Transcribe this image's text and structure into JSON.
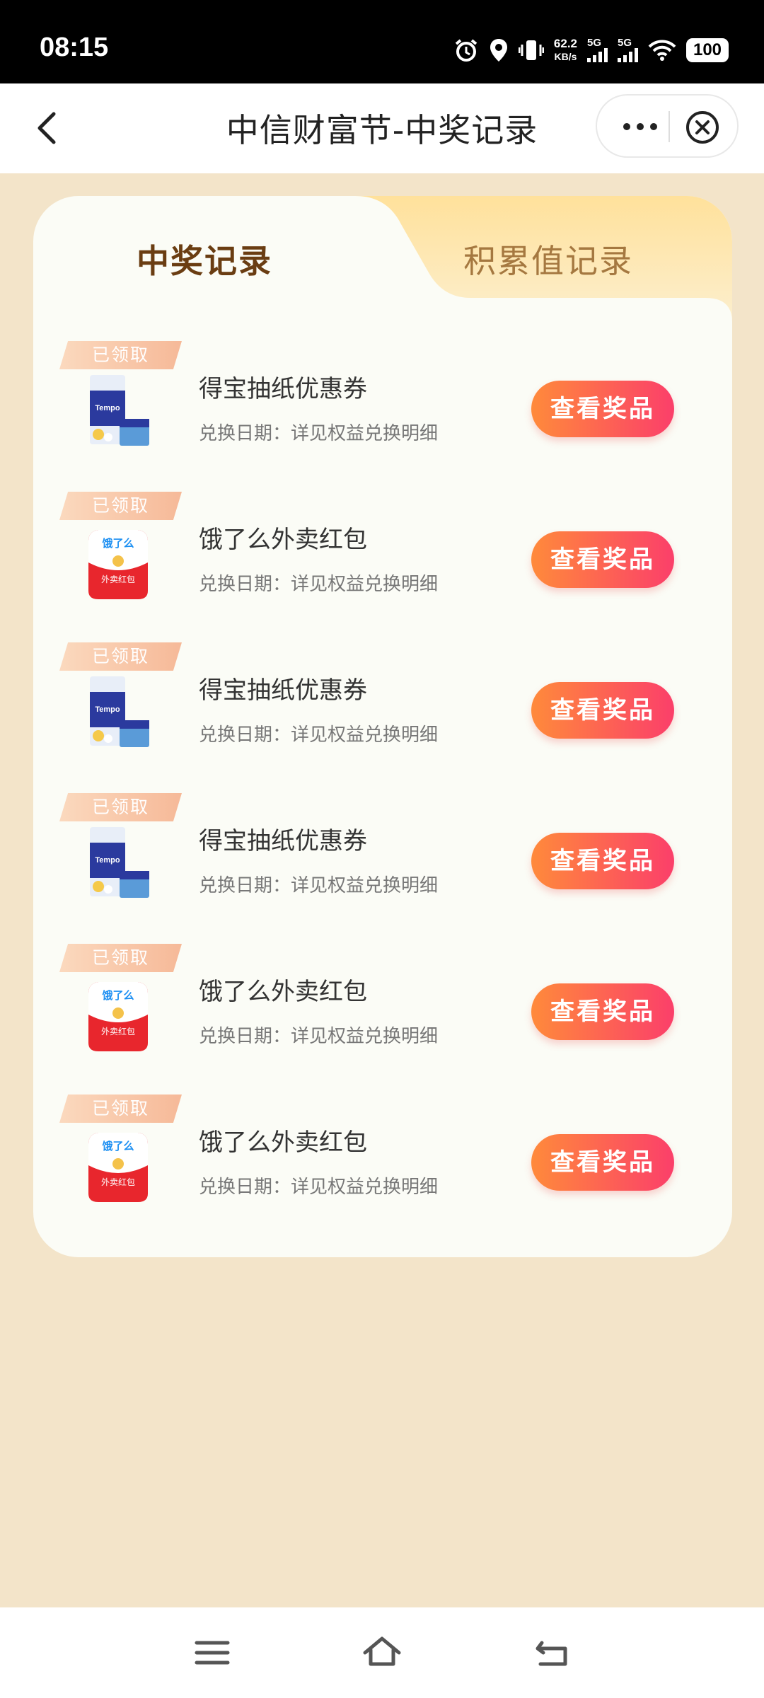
{
  "status_bar": {
    "time": "08:15",
    "net_speed": "62.2",
    "net_unit": "KB/s",
    "sim1": "5G",
    "sim2": "5G",
    "battery": "100",
    "icons": [
      "alarm-icon",
      "location-icon",
      "vibrate-icon",
      "signal-icon",
      "signal-icon",
      "wifi-icon",
      "battery-icon"
    ]
  },
  "header": {
    "title": "中信财富节-中奖记录",
    "back_icon": "chevron-left-icon",
    "more_icon": "more-dots-icon",
    "close_icon": "close-circle-icon"
  },
  "tabs": [
    {
      "label": "中奖记录",
      "active": true
    },
    {
      "label": "积累值记录",
      "active": false
    }
  ],
  "records": [
    {
      "status": "已领取",
      "title": "得宝抽纸优惠券",
      "date": "兑换日期：详见权益兑换明细",
      "button": "查看奖品",
      "thumb": "tissue"
    },
    {
      "status": "已领取",
      "title": "饿了么外卖红包",
      "date": "兑换日期：详见权益兑换明细",
      "button": "查看奖品",
      "thumb": "eleme"
    },
    {
      "status": "已领取",
      "title": "得宝抽纸优惠券",
      "date": "兑换日期：详见权益兑换明细",
      "button": "查看奖品",
      "thumb": "tissue"
    },
    {
      "status": "已领取",
      "title": "得宝抽纸优惠券",
      "date": "兑换日期：详见权益兑换明细",
      "button": "查看奖品",
      "thumb": "tissue"
    },
    {
      "status": "已领取",
      "title": "饿了么外卖红包",
      "date": "兑换日期：详见权益兑换明细",
      "button": "查看奖品",
      "thumb": "eleme"
    },
    {
      "status": "已领取",
      "title": "饿了么外卖红包",
      "date": "兑换日期：详见权益兑换明细",
      "button": "查看奖品",
      "thumb": "eleme"
    }
  ],
  "thumb_text": {
    "tissue_brand": "Tempo",
    "eleme_logo": "饿了么",
    "eleme_label": "外卖红包"
  },
  "colors": {
    "page_bg": "#f3e4c9",
    "card_bg": "#fbfcf6",
    "button_start": "#ff8a3b",
    "button_end": "#fb3f6a",
    "active_tab_text": "#6a3d12",
    "inactive_tab_text": "#a57840",
    "inactive_tab_bg": "#fde3a8"
  },
  "nav_bar": {
    "icons": [
      "menu-icon",
      "home-icon",
      "back-icon"
    ]
  }
}
